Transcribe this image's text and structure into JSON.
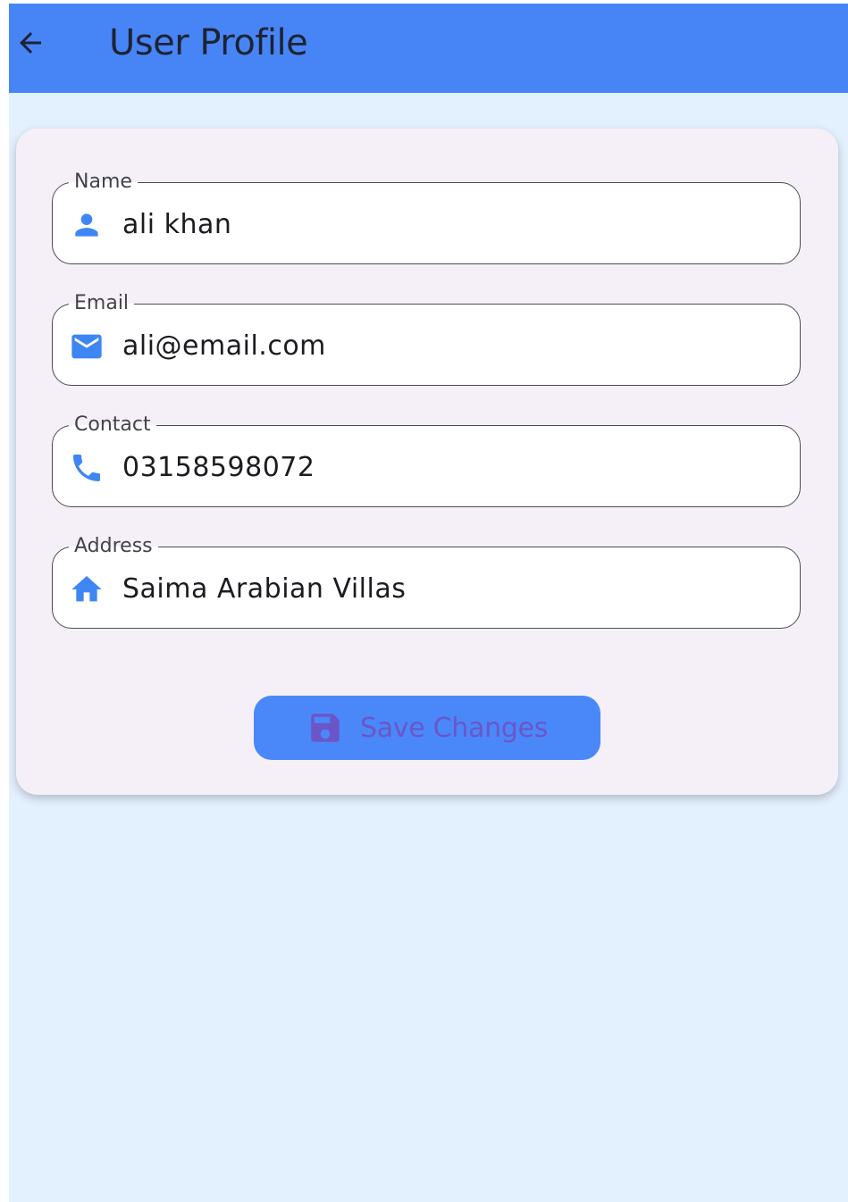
{
  "appbar": {
    "title": "User Profile",
    "back_icon": "arrow-left-icon"
  },
  "form": {
    "fields": [
      {
        "label": "Name",
        "value": "ali khan",
        "icon": "person-icon"
      },
      {
        "label": "Email",
        "value": "ali@email.com",
        "icon": "mail-icon"
      },
      {
        "label": "Contact",
        "value": "03158598072",
        "icon": "phone-icon"
      },
      {
        "label": "Address",
        "value": "Saima Arabian Villas",
        "icon": "home-icon"
      }
    ],
    "save_button": {
      "label": "Save Changes",
      "icon": "save-icon"
    }
  },
  "colors": {
    "appbar": "#4785f7",
    "background": "#e3f0fd",
    "card": "#f5f0f8",
    "icon_accent": "#3f86f5",
    "button": "#4a88fa",
    "button_text": "#6b56c8"
  }
}
